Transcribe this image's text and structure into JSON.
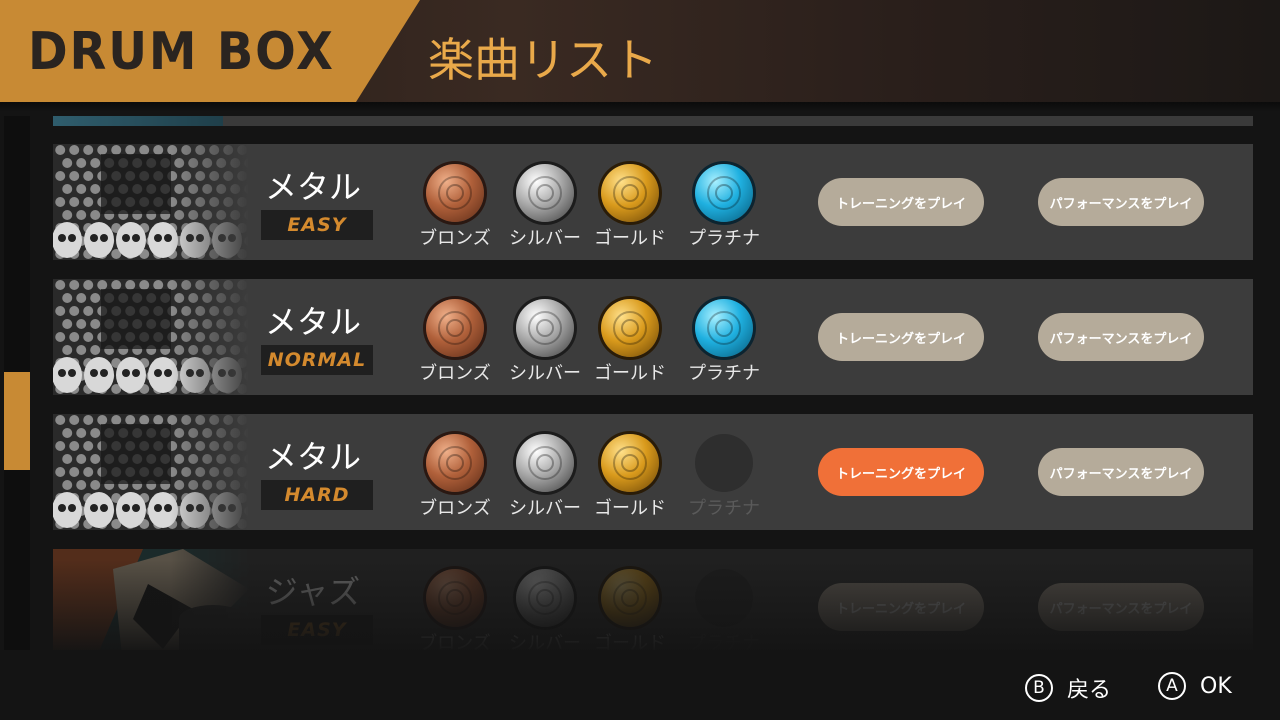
{
  "header": {
    "logo": "DRUM BOX",
    "title": "楽曲リスト"
  },
  "medal_labels": [
    "ブロンズ",
    "シルバー",
    "ゴールド",
    "プラチナ"
  ],
  "songs": [
    {
      "name": "メタル",
      "difficulty": "EASY",
      "thumbnail": "skull-art",
      "medals": [
        "bronze",
        "silver",
        "gold",
        "platinum"
      ],
      "training_label": "トレーニングをプレイ",
      "performance_label": "パフォーマンスをプレイ",
      "selected_button": null,
      "dimmed": false
    },
    {
      "name": "メタル",
      "difficulty": "NORMAL",
      "thumbnail": "skull-art",
      "medals": [
        "bronze",
        "silver",
        "gold",
        "platinum"
      ],
      "training_label": "トレーニングをプレイ",
      "performance_label": "パフォーマンスをプレイ",
      "selected_button": null,
      "dimmed": false
    },
    {
      "name": "メタル",
      "difficulty": "HARD",
      "thumbnail": "skull-art",
      "medals": [
        "bronze",
        "silver",
        "gold",
        "empty"
      ],
      "training_label": "トレーニングをプレイ",
      "performance_label": "パフォーマンスをプレイ",
      "selected_button": "training",
      "dimmed": false
    },
    {
      "name": "ジャズ",
      "difficulty": "EASY",
      "thumbnail": "jazz-art",
      "medals": [
        "bronze",
        "silver",
        "gold",
        "empty"
      ],
      "training_label": "トレーニングをプレイ",
      "performance_label": "パフォーマンスをプレイ",
      "selected_button": null,
      "dimmed": true
    }
  ],
  "scroll": {
    "position": 0.5
  },
  "footer": {
    "back_glyph": "B",
    "back_label": "戻る",
    "ok_glyph": "A",
    "ok_label": "OK"
  },
  "colors": {
    "accent": "#c88a34",
    "selected_button": "#f07038",
    "button": "#b5ab9a",
    "difficulty_text": "#d48a2e"
  }
}
